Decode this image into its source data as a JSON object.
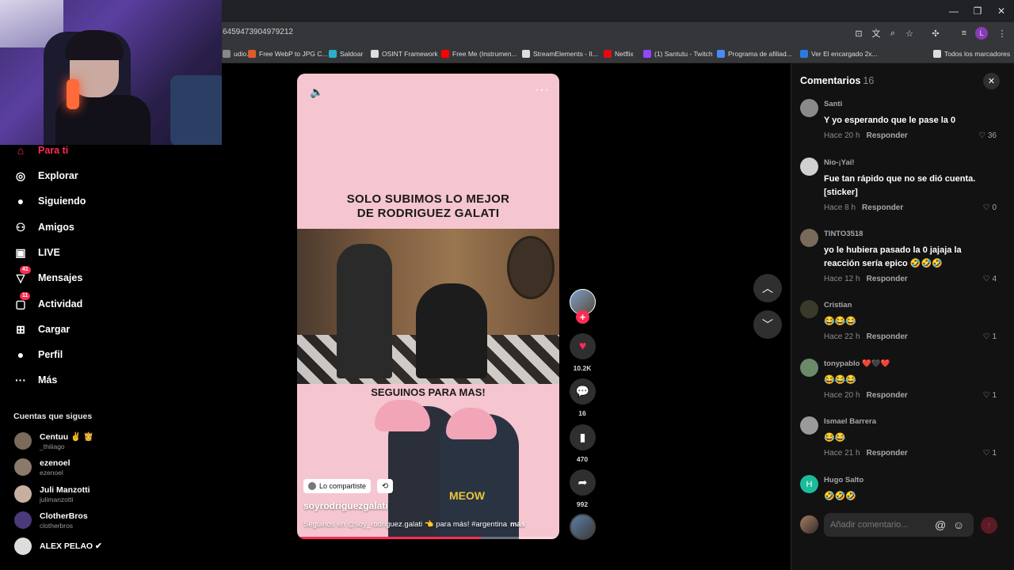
{
  "browser": {
    "url": "6459473904979212",
    "bookmarks": [
      {
        "label": "udio...",
        "color": "#888888"
      },
      {
        "label": "Free WebP to JPG C...",
        "color": "#e05a2a"
      },
      {
        "label": "Saldoar",
        "color": "#2ab0c8"
      },
      {
        "label": "OSINT Framework",
        "color": "#dddddd"
      },
      {
        "label": "Free Me (Instrumen...",
        "color": "#ff0000"
      },
      {
        "label": "StreamElements - Il...",
        "color": "#dddddd"
      },
      {
        "label": "Netflix",
        "color": "#e50914"
      },
      {
        "label": "(1) Santutu - Twitch",
        "color": "#9146ff"
      },
      {
        "label": "Programa de afiliad...",
        "color": "#4a8af4"
      },
      {
        "label": "Ver El encargado 2x...",
        "color": "#2a7ae2"
      },
      {
        "label": "Todos los marcadores",
        "color": "#dddddd"
      }
    ],
    "window_controls": [
      "—",
      "❐",
      "✕"
    ]
  },
  "sidebar": {
    "items": [
      {
        "label": "Para ti",
        "icon": "home-icon",
        "glyph": "⌂",
        "badge": ""
      },
      {
        "label": "Explorar",
        "icon": "compass-icon",
        "glyph": "◎",
        "badge": ""
      },
      {
        "label": "Siguiendo",
        "icon": "following-avatar-icon",
        "glyph": "●",
        "badge": ""
      },
      {
        "label": "Amigos",
        "icon": "friends-icon",
        "glyph": "⚇",
        "badge": ""
      },
      {
        "label": "LIVE",
        "icon": "live-icon",
        "glyph": "▣",
        "badge": ""
      },
      {
        "label": "Mensajes",
        "icon": "messages-icon",
        "glyph": "▽",
        "badge": "41"
      },
      {
        "label": "Actividad",
        "icon": "activity-icon",
        "glyph": "▢",
        "badge": "11"
      },
      {
        "label": "Cargar",
        "icon": "upload-icon",
        "glyph": "⊞",
        "badge": ""
      },
      {
        "label": "Perfil",
        "icon": "profile-avatar-icon",
        "glyph": "●",
        "badge": ""
      },
      {
        "label": "Más",
        "icon": "more-icon",
        "glyph": "···",
        "badge": ""
      }
    ],
    "following_title": "Cuentas que sigues",
    "accounts": [
      {
        "name": "Centuu ✌️ 👸",
        "handle": "_thiiiago"
      },
      {
        "name": "ezenoel",
        "handle": "ezenoel"
      },
      {
        "name": "Juli Manzotti",
        "handle": "julimanzotti"
      },
      {
        "name": "ClotherBros",
        "handle": "clotherbros"
      },
      {
        "name": "ALEX PELAO ✔",
        "handle": ""
      }
    ]
  },
  "video": {
    "overlay_line1": "SOLO SUBIMOS LO MEJOR",
    "overlay_line2": "DE RODRIGUEZ GALATI",
    "overlay_sub": "SEGUINOS PARA MAS!",
    "shirt_text": "MEOW",
    "shared_label": "Lo compartiste",
    "author": "soyrodriguezgalati",
    "caption": "Seguinos en @soy_rodriguez.galati 👈 para más! #argentina",
    "more_label": "más",
    "progress": 0.7
  },
  "actions": {
    "likes": "10.2K",
    "comments": "16",
    "saves": "470",
    "shares": "992"
  },
  "comments": {
    "title": "Comentarios",
    "count": "16",
    "reply_label": "Responder",
    "input_placeholder": "Añadir comentario...",
    "items": [
      {
        "user": "Santi",
        "text": "Y yo esperando que le pase la 0",
        "time": "Hace 20 h",
        "likes": "36",
        "avatar": "#8a8a8a"
      },
      {
        "user": "Nio-¡Yai!",
        "text": "Fue tan rápido que no se dió cuenta. [sticker]",
        "time": "Hace 8 h",
        "likes": "0",
        "avatar": "#d0d0d0"
      },
      {
        "user": "TINTO3518",
        "text": "yo le hubiera pasado la 0 jajaja la reacción sería epico 🤣🤣🤣",
        "time": "Hace 12 h",
        "likes": "4",
        "avatar": "#7a6a5a"
      },
      {
        "user": "Cristian",
        "text": "😂😂😂",
        "time": "Hace 22 h",
        "likes": "1",
        "avatar": "#3a3a2a"
      },
      {
        "user": "tonypablo ❤️🖤❤️",
        "text": "😂😂😂",
        "time": "Hace 20 h",
        "likes": "1",
        "avatar": "#6a8a6a"
      },
      {
        "user": "Ismael Barrera",
        "text": "😂😂",
        "time": "Hace 21 h",
        "likes": "1",
        "avatar": "#9a9a9a"
      },
      {
        "user": "Hugo Salto",
        "text": "🤣🤣🤣",
        "time": "",
        "likes": "",
        "avatar": "#1abc9c",
        "initial": "H"
      }
    ]
  },
  "colors": {
    "accent": "#fe2c55",
    "panel_bg": "#121212"
  }
}
